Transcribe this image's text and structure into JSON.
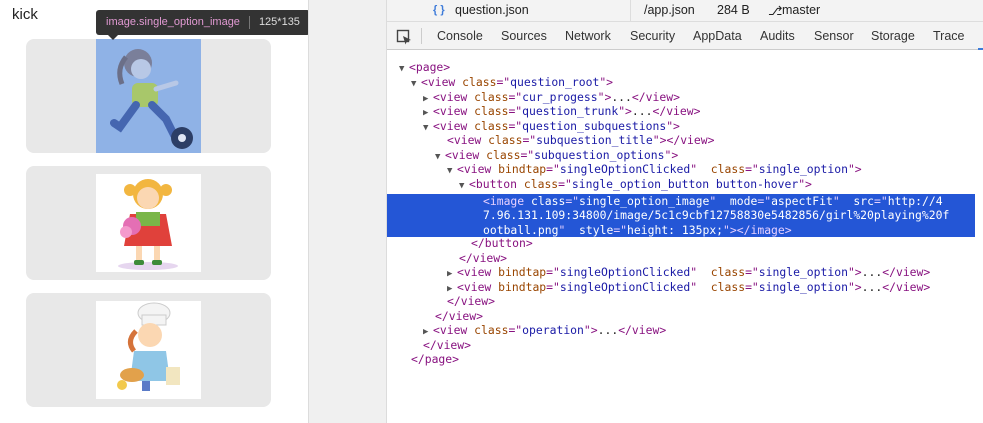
{
  "simulator": {
    "title": "kick",
    "tooltip": {
      "name": "image.single_option_image",
      "size": "125*135"
    },
    "cards": [
      {
        "image": "girl-playing-football",
        "highlighted": true
      },
      {
        "image": "girl-with-bouquet",
        "highlighted": false
      },
      {
        "image": "girl-chef-cooking",
        "highlighted": false
      }
    ]
  },
  "devtools": {
    "file_bar": {
      "file_name": "question.json",
      "app_file": "/app.json",
      "file_size": "284 B",
      "branch": "master"
    },
    "tabs": [
      "Console",
      "Sources",
      "Network",
      "Security",
      "AppData",
      "Audits",
      "Sensor",
      "Storage",
      "Trace"
    ],
    "tree": {
      "page_tag": "page",
      "root_class": "question_root",
      "cur_progess": "cur_progess",
      "question_trunk": "question_trunk",
      "question_subquestions": "question_subquestions",
      "subquestion_title": "subquestion_title",
      "subquestion_options": "subquestion_options",
      "bindtap_value": "singleOptionClicked",
      "single_option": "single_option",
      "button_class": "single_option_button button-hover",
      "image_class": "single_option_image",
      "image_mode": "aspectFit",
      "image_src_1": "http://4",
      "image_src_2": "7.96.131.109:34800/image/5c1c9cbf12758830e5482856/girl%20playing%20f",
      "image_src_3": "ootball.png",
      "image_style": "height: 135px;",
      "operation": "operation",
      "ellipsis": "..."
    }
  }
}
